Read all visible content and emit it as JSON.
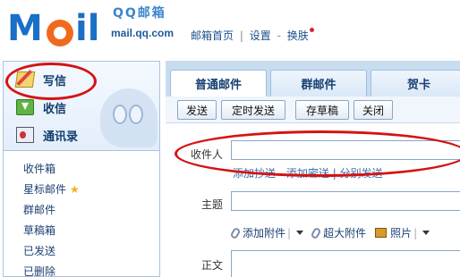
{
  "header": {
    "logo_letters_1": "M",
    "logo_letters_2": "il",
    "logo_cn": "QQ邮箱",
    "logo_url": "mail.qq.com",
    "links": {
      "home": "邮箱首页",
      "sep1": "|",
      "settings": "设置",
      "sep2": "-",
      "skin": "换肤"
    }
  },
  "sidebar": {
    "actions": {
      "compose": "写信",
      "inbox": "收信",
      "contacts": "通讯录"
    },
    "folders": [
      {
        "label": "收件箱"
      },
      {
        "label": "星标邮件"
      },
      {
        "label": "群邮件"
      },
      {
        "label": "草稿箱"
      },
      {
        "label": "已发送"
      },
      {
        "label": "已删除"
      }
    ]
  },
  "tabs": [
    {
      "label": "普通邮件",
      "active": true
    },
    {
      "label": "群邮件",
      "active": false
    },
    {
      "label": "贺卡",
      "active": false
    }
  ],
  "toolbar": {
    "send": "发送",
    "schedule": "定时发送",
    "save_draft": "存草稿",
    "close": "关闭"
  },
  "compose": {
    "to_label": "收件人",
    "to_value": "",
    "hint": "添加抄送 - 添加密送 | 分别发送",
    "subject_label": "主题",
    "subject_value": "",
    "attach": "添加附件",
    "big_attach": "超大附件",
    "photo": "照片",
    "body_label": "正文"
  },
  "colors": {
    "annotation": "#d41313",
    "brand_blue": "#1a6fc6",
    "brand_orange": "#f06a1e",
    "tab_bar": "#c8dcf0"
  }
}
